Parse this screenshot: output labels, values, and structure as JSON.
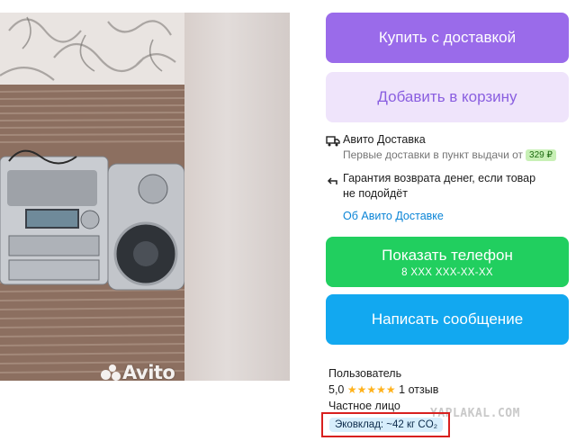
{
  "photo": {
    "watermark": "Avito"
  },
  "buttons": {
    "buy": "Купить с доставкой",
    "cart": "Добавить в корзину",
    "phone": "Показать телефон",
    "phone_sub": "8 XXX XXX-XX-XX",
    "message": "Написать сообщение"
  },
  "delivery": {
    "title": "Авито Доставка",
    "first_delivery": "Первые доставки в пункт выдачи от",
    "price": "329 ₽",
    "guarantee_line1": "Гарантия возврата денег, если товар",
    "guarantee_line2": "не подойдёт",
    "link": "Об Авито Доставке"
  },
  "seller": {
    "name": "Пользователь",
    "rating": "5,0",
    "stars": "★★★★★",
    "reviews": "1 отзыв",
    "type": "Частное лицо",
    "eco": "Эковклад: ~42 кг CO₂"
  },
  "watermark_site": "YAPLAKAL.COM",
  "colors": {
    "buy": "#9a6bea",
    "cart": "#efe4fb",
    "phone": "#21cf5f",
    "message": "#12a8f0",
    "link": "#0a84d6",
    "eco_frame": "#d8201e"
  },
  "icons": [
    "truck-icon",
    "return-arrow-icon",
    "avito-logo-icon"
  ]
}
